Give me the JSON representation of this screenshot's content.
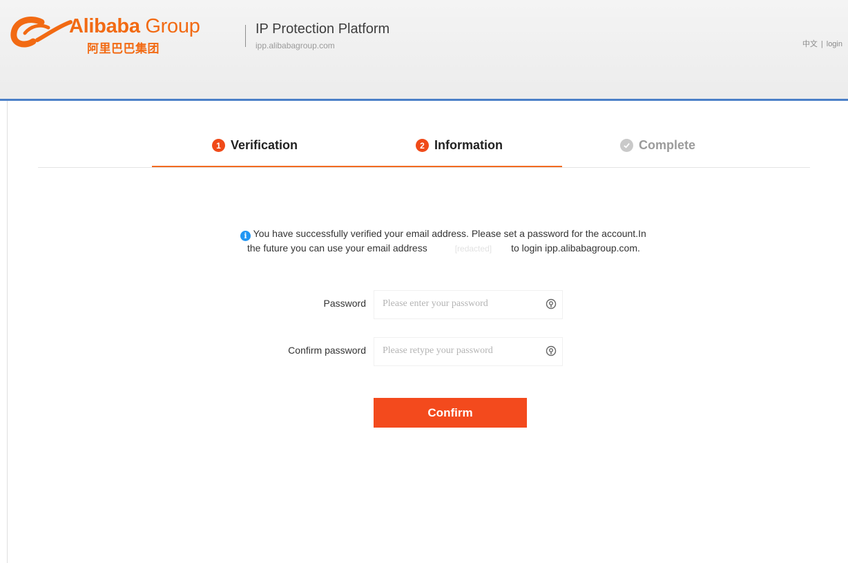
{
  "header": {
    "brand_en_bold": "Alibaba",
    "brand_en_light": "Group",
    "brand_cn": "阿里巴巴集团",
    "platform_title": "IP Protection Platform",
    "platform_url": "ipp.alibabagroup.com",
    "lang_link": "中文",
    "login_link": "login",
    "brand_color": "#f26a13"
  },
  "steps": [
    {
      "number": "1",
      "label": "Verification",
      "state": "done"
    },
    {
      "number": "2",
      "label": "Information",
      "state": "current"
    },
    {
      "label": "Complete",
      "state": "pending",
      "icon": "check-circle-icon"
    }
  ],
  "message": {
    "line1": "You have successfully verified your email address. Please set a password for the account.In",
    "line2_before": "the future you can use your email address",
    "redacted": "[redacted]",
    "line2_after": "to login ipp.alibabagroup.com."
  },
  "form": {
    "password_label": "Password",
    "password_placeholder": "Please enter your password",
    "confirm_label": "Confirm password",
    "confirm_placeholder": "Please retype your password"
  },
  "confirm_button": "Confirm",
  "colors": {
    "accent": "#f34a1d",
    "header_rule": "#4a7fc7",
    "info": "#2196f3"
  }
}
